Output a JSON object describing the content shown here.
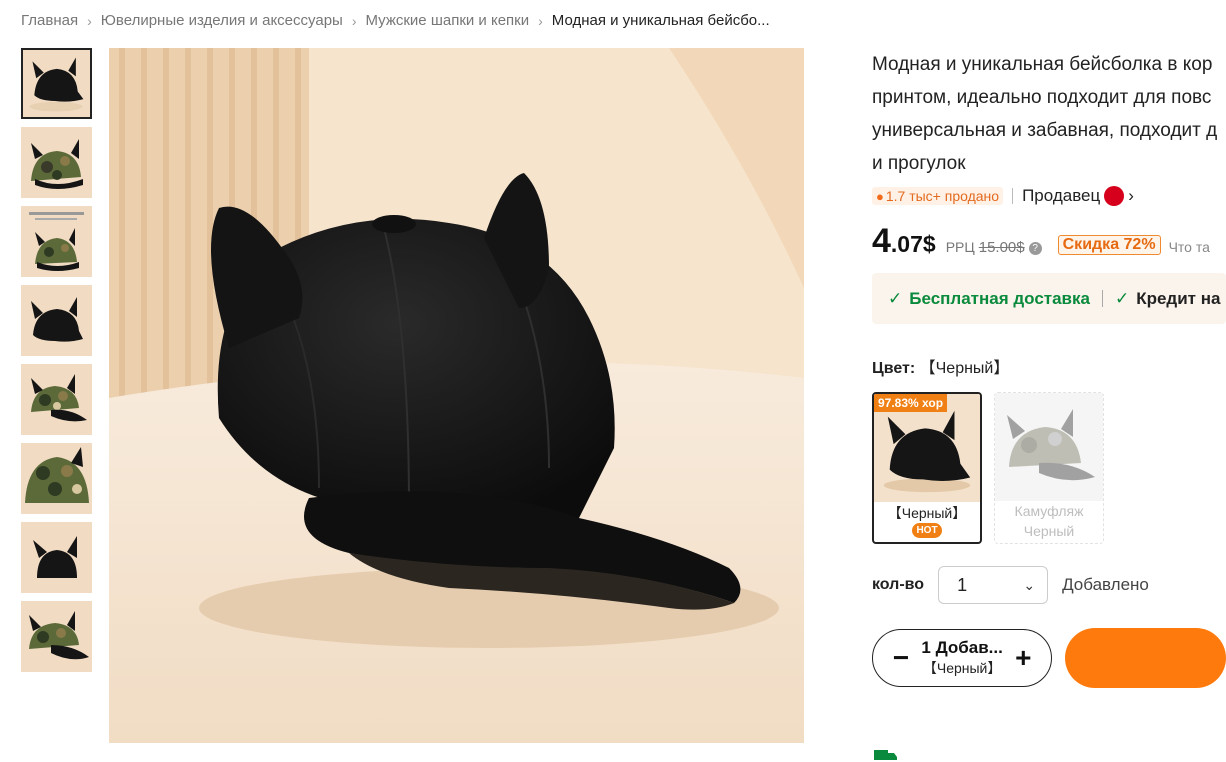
{
  "breadcrumb": [
    "Главная",
    "Ювелирные изделия и аксессуары",
    "Мужские шапки и кепки",
    "Модная и уникальная бейсбо..."
  ],
  "thumbnails": [
    {
      "variant": "black"
    },
    {
      "variant": "camo"
    },
    {
      "variant": "camo-size-chart"
    },
    {
      "variant": "black"
    },
    {
      "variant": "camo"
    },
    {
      "variant": "camo-back"
    },
    {
      "variant": "black-back"
    },
    {
      "variant": "camo"
    }
  ],
  "product": {
    "title_lines": [
      "Модная и уникальная бейсболка в кор",
      "принтом, идеально подходит для повс",
      "универсальная и забавная, подходит д",
      "и прогулок"
    ],
    "sold": "1.7 тыс+ продано",
    "seller_label": "Продавец",
    "price_int": "4",
    "price_frac": ".07$",
    "rrp_label": "РРЦ",
    "rrp_value": "15.00$",
    "discount": "Скидка 72%",
    "extra": "Что та"
  },
  "benefits": {
    "shipping": "Бесплатная доставка",
    "credit": "Кредит на"
  },
  "color": {
    "label": "Цвет:",
    "selected": "【Черный】",
    "options": [
      {
        "badge": "97.83% хор",
        "label": "【Черный】",
        "hot": "HOT"
      },
      {
        "label_line1": "Камуфляж",
        "label_line2": "Черный"
      }
    ]
  },
  "quantity": {
    "label": "кол-во",
    "value": "1",
    "added": "Добавлено"
  },
  "cart": {
    "main": "1 Добав...",
    "sub": "【Черный】"
  },
  "colors": {
    "accent": "#ff7a0c",
    "green": "#0a8a3c",
    "background_beige": "#f3e1cc"
  }
}
